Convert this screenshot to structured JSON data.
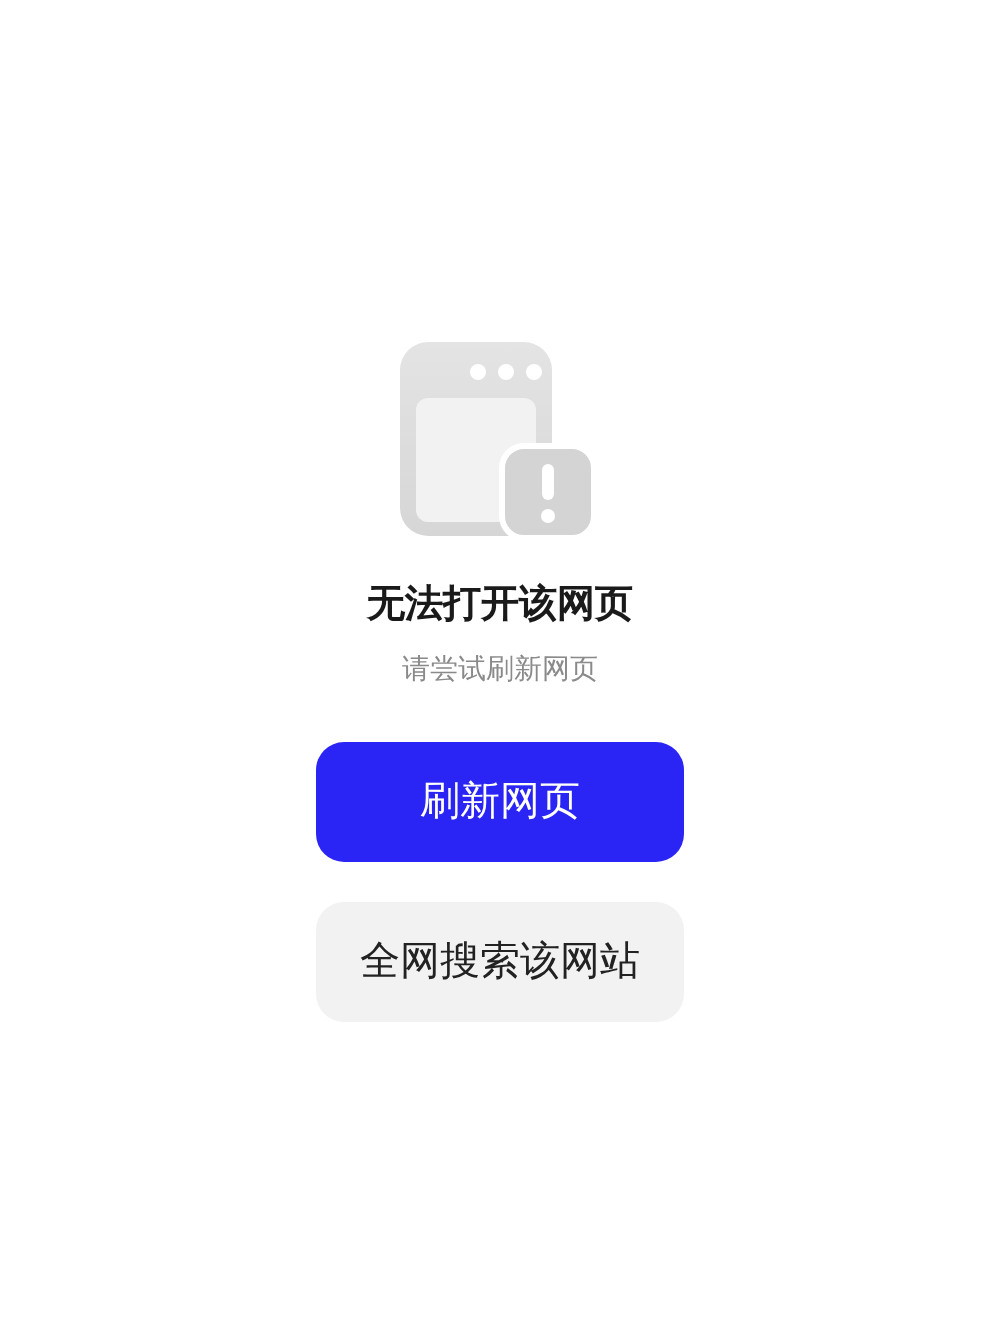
{
  "error": {
    "title": "无法打开该网页",
    "message": "请尝试刷新网页"
  },
  "buttons": [
    {
      "label": "刷新网页",
      "kind": "primary"
    },
    {
      "label": "全网搜索该网站",
      "kind": "secondary"
    }
  ]
}
